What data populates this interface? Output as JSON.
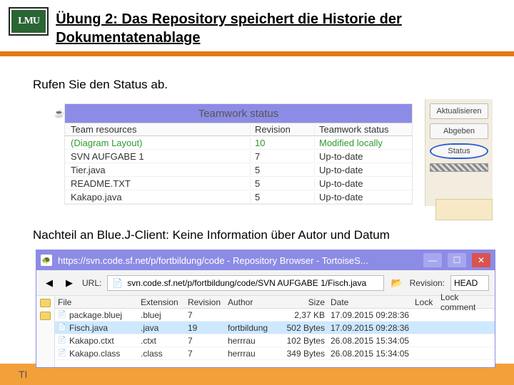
{
  "header": {
    "logo_text": "LMU",
    "title": "Übung 2: Das Repository speichert die Historie der Dokumentatenablage"
  },
  "body": {
    "line1": "Rufen Sie den Status ab.",
    "caption": "Nachteil an Blue.J-Client: Keine Information über Autor und Datum"
  },
  "teamwork": {
    "window_title": "Teamwork status",
    "columns": {
      "c1": "Team resources",
      "c2": "Revision",
      "c3": "Teamwork status"
    },
    "rows": [
      {
        "c1": "(Diagram Layout)",
        "c2": "10",
        "c3": "Modified locally",
        "green": true
      },
      {
        "c1": "SVN AUFGABE 1",
        "c2": "7",
        "c3": "Up-to-date"
      },
      {
        "c1": "Tier.java",
        "c2": "5",
        "c3": "Up-to-date"
      },
      {
        "c1": "README.TXT",
        "c2": "5",
        "c3": "Up-to-date"
      },
      {
        "c1": "Kakapo.java",
        "c2": "5",
        "c3": "Up-to-date"
      }
    ],
    "buttons": {
      "b1": "Aktualisieren",
      "b2": "Abgeben",
      "b3": "Status"
    }
  },
  "browser": {
    "title": "https://svn.code.sf.net/p/fortbildung/code - Repository Browser - TortoiseS...",
    "url_label": "URL:",
    "url_value": "svn.code.sf.net/p/fortbildung/code/SVN AUFGABE 1/Fisch.java",
    "rev_label": "Revision:",
    "rev_value": "HEAD",
    "columns": {
      "file": "File",
      "ext": "Extension",
      "rev": "Revision",
      "auth": "Author",
      "size": "Size",
      "date": "Date",
      "lock": "Lock",
      "lc": "Lock comment"
    },
    "rows": [
      {
        "file": "package.bluej",
        "ext": ".bluej",
        "rev": "7",
        "auth": "",
        "size": "2,37 KB",
        "date": "17.09.2015 09:28:36"
      },
      {
        "file": "Fisch.java",
        "ext": ".java",
        "rev": "19",
        "auth": "fortbildung",
        "size": "502 Bytes",
        "date": "17.09.2015 09:28:36",
        "sel": true
      },
      {
        "file": "Kakapo.ctxt",
        "ext": ".ctxt",
        "rev": "7",
        "auth": "herrrau",
        "size": "102 Bytes",
        "date": "26.08.2015 15:34:05"
      },
      {
        "file": "Kakapo.class",
        "ext": ".class",
        "rev": "7",
        "auth": "herrrau",
        "size": "349 Bytes",
        "date": "26.08.2015 15:34:05"
      }
    ]
  },
  "footer": {
    "text": "TI"
  }
}
